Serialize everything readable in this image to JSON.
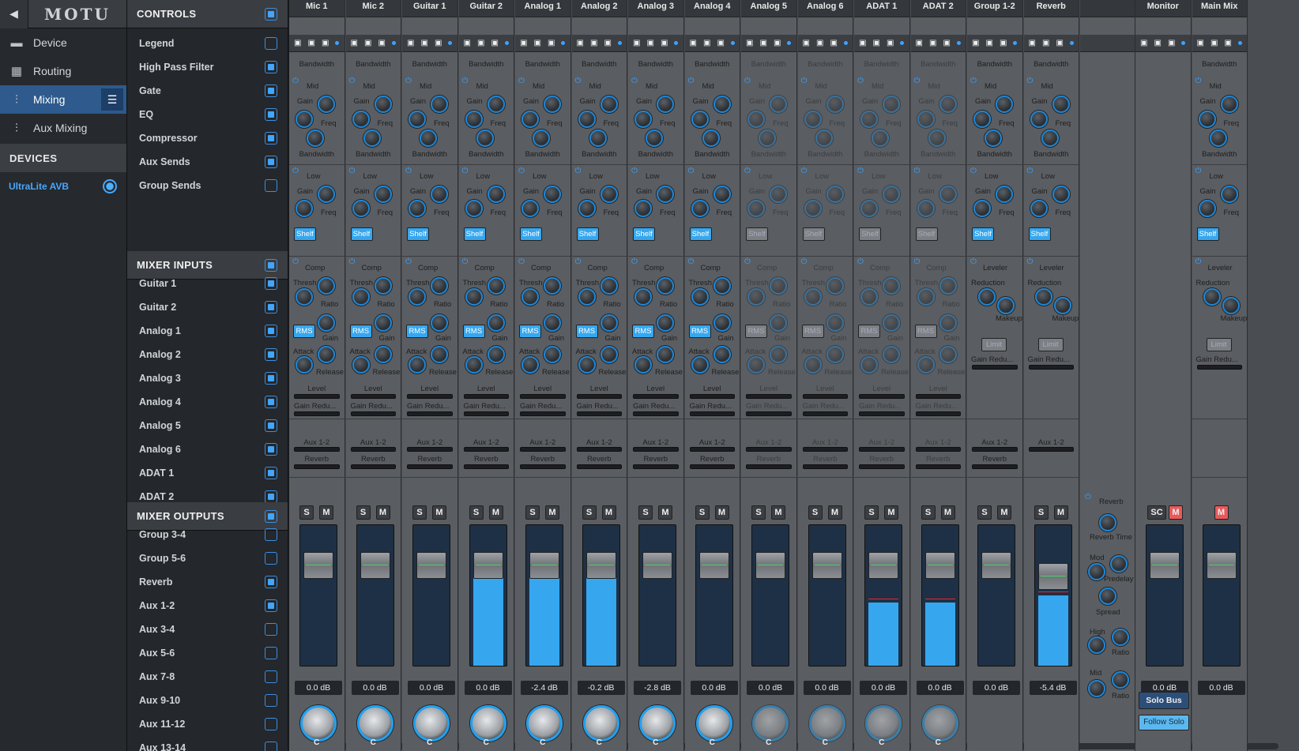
{
  "nav": {
    "back": "◀",
    "brand": "MOTU",
    "items": [
      {
        "label": "Device",
        "icon": "device-icon"
      },
      {
        "label": "Routing",
        "icon": "routing-grid-icon"
      },
      {
        "label": "Mixing",
        "icon": "mixer-sliders-icon"
      },
      {
        "label": "Aux Mixing",
        "icon": "aux-sliders-icon"
      }
    ],
    "devices_header": "DEVICES",
    "device": "UltraLite AVB"
  },
  "controls": {
    "header": "CONTROLS",
    "items": [
      {
        "label": "Legend",
        "on": false
      },
      {
        "label": "High Pass Filter",
        "on": true
      },
      {
        "label": "Gate",
        "on": true
      },
      {
        "label": "EQ",
        "on": true
      },
      {
        "label": "Compressor",
        "on": true
      },
      {
        "label": "Aux Sends",
        "on": true
      },
      {
        "label": "Group Sends",
        "on": false
      }
    ]
  },
  "inputs": {
    "header": "MIXER INPUTS",
    "items": [
      {
        "label": "Guitar 1",
        "on": true
      },
      {
        "label": "Guitar 2",
        "on": true
      },
      {
        "label": "Analog 1",
        "on": true
      },
      {
        "label": "Analog 2",
        "on": true
      },
      {
        "label": "Analog 3",
        "on": true
      },
      {
        "label": "Analog 4",
        "on": true
      },
      {
        "label": "Analog 5",
        "on": true
      },
      {
        "label": "Analog 6",
        "on": true
      },
      {
        "label": "ADAT 1",
        "on": true
      },
      {
        "label": "ADAT 2",
        "on": true
      }
    ]
  },
  "outputs": {
    "header": "MIXER OUTPUTS",
    "items": [
      {
        "label": "Group 3-4",
        "on": false
      },
      {
        "label": "Group 5-6",
        "on": false
      },
      {
        "label": "Reverb",
        "on": true
      },
      {
        "label": "Aux 1-2",
        "on": true
      },
      {
        "label": "Aux 3-4",
        "on": false
      },
      {
        "label": "Aux 5-6",
        "on": false
      },
      {
        "label": "Aux 7-8",
        "on": false
      },
      {
        "label": "Aux 9-10",
        "on": false
      },
      {
        "label": "Aux 11-12",
        "on": false
      },
      {
        "label": "Aux 13-14",
        "on": false
      }
    ]
  },
  "labels": {
    "bandwidth": "Bandwidth",
    "mid": "Mid",
    "low": "Low",
    "gain": "Gain",
    "freq": "Freq",
    "shelf": "Shelf",
    "comp": "Comp",
    "thresh": "Thresh",
    "ratio": "Ratio",
    "rms": "RMS",
    "attack": "Attack",
    "release": "Release",
    "level": "Level",
    "gain_red": "Gain Redu...",
    "aux": "Aux 1-2",
    "reverb": "Reverb",
    "s": "S",
    "m": "M",
    "pan": "C",
    "leveler": "Leveler",
    "reduction": "Reduction",
    "makeup": "Makeup",
    "limit": "Limit",
    "sc": "SC"
  },
  "strips": [
    {
      "name": "Mic 1",
      "db": "0.0 dB",
      "active": true,
      "fill": 0,
      "type": "ch"
    },
    {
      "name": "Mic 2",
      "db": "0.0 dB",
      "active": true,
      "fill": 0,
      "type": "ch"
    },
    {
      "name": "Guitar 1",
      "db": "0.0 dB",
      "active": true,
      "fill": 0,
      "type": "ch"
    },
    {
      "name": "Guitar 2",
      "db": "0.0 dB",
      "active": true,
      "fill": 0.72,
      "type": "ch"
    },
    {
      "name": "Analog 1",
      "db": "-2.4 dB",
      "active": true,
      "fill": 0.68,
      "type": "ch"
    },
    {
      "name": "Analog 2",
      "db": "-0.2 dB",
      "active": true,
      "fill": 0.72,
      "type": "ch"
    },
    {
      "name": "Analog 3",
      "db": "-2.8 dB",
      "active": true,
      "fill": 0,
      "type": "ch"
    },
    {
      "name": "Analog 4",
      "db": "0.0 dB",
      "active": true,
      "fill": 0,
      "type": "ch"
    },
    {
      "name": "Analog 5",
      "db": "0.0 dB",
      "active": false,
      "fill": 0,
      "type": "ch"
    },
    {
      "name": "Analog 6",
      "db": "0.0 dB",
      "active": false,
      "fill": 0,
      "type": "ch"
    },
    {
      "name": "ADAT 1",
      "db": "0.0 dB",
      "active": false,
      "fill": 0.45,
      "type": "ch"
    },
    {
      "name": "ADAT 2",
      "db": "0.0 dB",
      "active": false,
      "fill": 0.45,
      "type": "ch"
    },
    {
      "name": "Group 1-2",
      "db": "0.0 dB",
      "active": true,
      "fill": 0,
      "type": "grp"
    },
    {
      "name": "Reverb",
      "db": "-5.4 dB",
      "active": true,
      "fill": 0.5,
      "type": "rev"
    },
    {
      "name": "Monitor",
      "db": "0.0 dB",
      "active": true,
      "fill": 0,
      "type": "mon"
    },
    {
      "name": "Main Mix",
      "db": "0.0 dB",
      "active": true,
      "fill": 0,
      "type": "main"
    }
  ],
  "reverb_fx": {
    "title": "Reverb",
    "reverb_time": "Reverb Time",
    "mod": "Mod",
    "predelay": "Predelay",
    "spread": "Spread",
    "high": "High",
    "ratio": "Ratio",
    "mid": "Mid"
  },
  "monitor": {
    "solo_bus": "Solo Bus",
    "follow_solo": "Follow Solo"
  }
}
